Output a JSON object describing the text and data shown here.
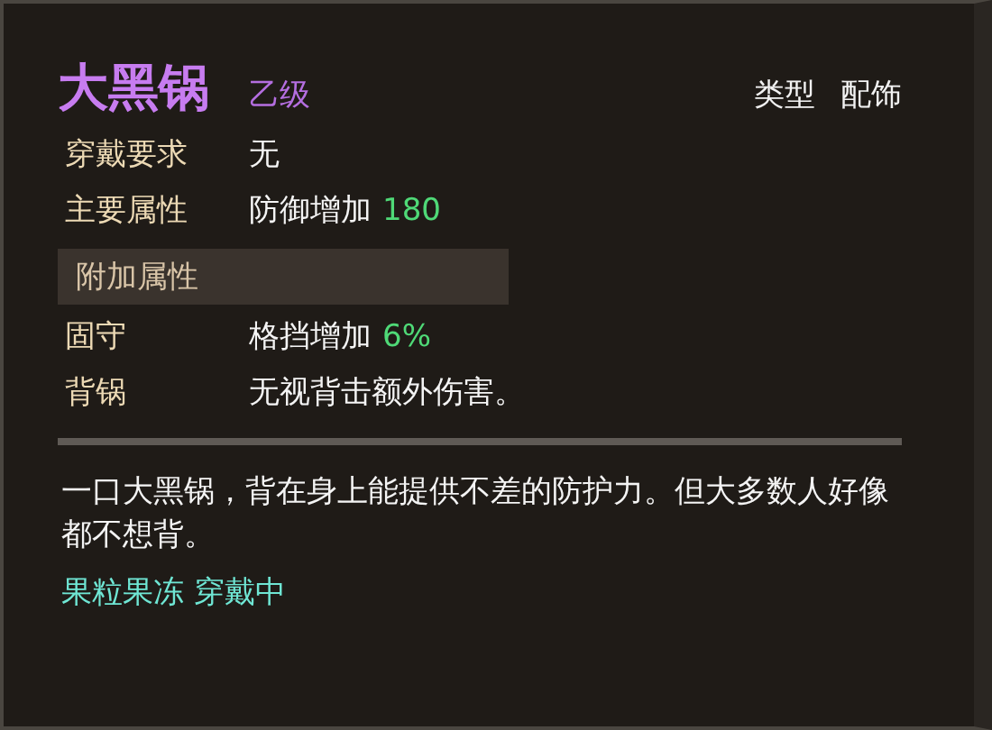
{
  "item": {
    "name": "大黑锅",
    "grade": "乙级",
    "type_label": "类型",
    "type_value": "配饰"
  },
  "requirement": {
    "label": "穿戴要求",
    "value": "无"
  },
  "main_attribute": {
    "label": "主要属性",
    "value": "防御增加",
    "amount": "180"
  },
  "extra_section": {
    "title": "附加属性"
  },
  "extra_attributes": [
    {
      "label": "固守",
      "value": "格挡增加",
      "amount": "6%"
    },
    {
      "label": "背锅",
      "value": "无视背击额外伤害。"
    }
  ],
  "description": "一口大黑锅，背在身上能提供不差的防护力。但大多数人好像都不想背。",
  "status": "果粒果冻 穿戴中"
}
